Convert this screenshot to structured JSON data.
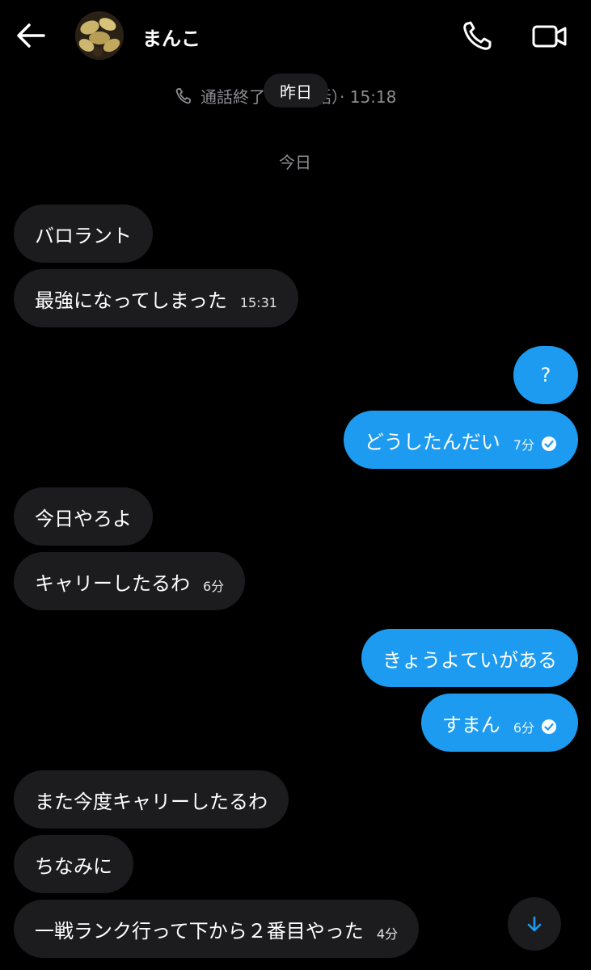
{
  "header": {
    "contact_name": "まんこ",
    "back_icon": "arrow-left-icon",
    "call_icon": "phone-icon",
    "video_icon": "video-camera-icon"
  },
  "call_log": {
    "text_left": "通話終了",
    "text_right": "通話）· 15:18",
    "icon": "phone-icon"
  },
  "date_pill": "昨日",
  "today_separator": "今日",
  "messages": [
    {
      "side": "in",
      "text": "バロラント",
      "time": ""
    },
    {
      "side": "in",
      "text": "最強になってしまった",
      "time": "15:31"
    },
    {
      "side": "out",
      "text": "?",
      "time": ""
    },
    {
      "side": "out",
      "text": "どうしたんだい",
      "time": "7分"
    },
    {
      "side": "in",
      "text": "今日やろよ",
      "time": ""
    },
    {
      "side": "in",
      "text": "キャリーしたるわ",
      "time": "6分"
    },
    {
      "side": "out",
      "text": "きょうよていがある",
      "time": ""
    },
    {
      "side": "out",
      "text": "すまん",
      "time": "6分"
    },
    {
      "side": "in",
      "text": "また今度キャリーしたるわ",
      "time": ""
    },
    {
      "side": "in",
      "text": "ちなみに",
      "time": ""
    },
    {
      "side": "in",
      "text": "一戦ランク行って下から２番目やった",
      "time": "4分"
    }
  ],
  "colors": {
    "outgoing_bubble": "#1d9bf0",
    "incoming_bubble": "#1c1c1e",
    "background": "#000000"
  },
  "scroll_down_icon": "arrow-down-icon"
}
